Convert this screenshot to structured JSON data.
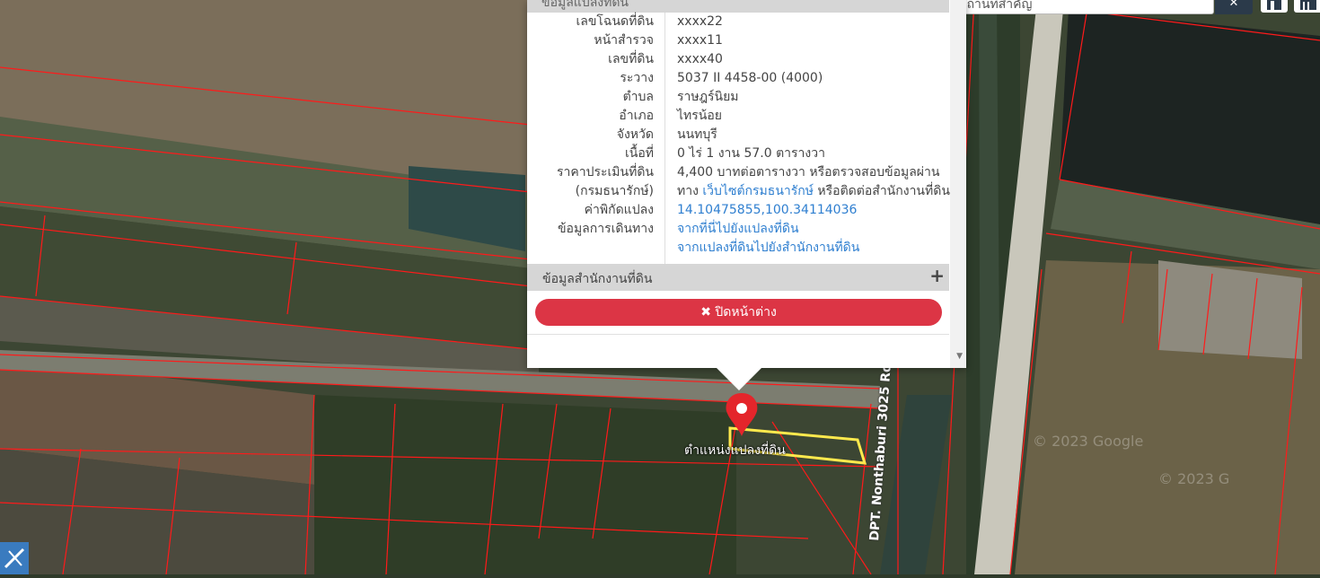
{
  "popup": {
    "header_title": "ข้อมูลแปลงที่ดิน",
    "rows": [
      {
        "label": "เลขโฉนดที่ดิน",
        "value": "xxxx22"
      },
      {
        "label": "หน้าสำรวจ",
        "value": "xxxx11"
      },
      {
        "label": "เลขที่ดิน",
        "value": "xxxx40"
      },
      {
        "label": "ระวาง",
        "value": "5037 II 4458-00 (4000)"
      },
      {
        "label": "ตำบล",
        "value": "ราษฎร์นิยม"
      },
      {
        "label": "อำเภอ",
        "value": "ไทรน้อย"
      },
      {
        "label": "จังหวัด",
        "value": "นนทบุรี"
      },
      {
        "label": "เนื้อที่",
        "value": "0 ไร่ 1 งาน 57.0 ตารางวา"
      }
    ],
    "price": {
      "label1": "ราคาประเมินที่ดิน",
      "label2": "(กรมธนารักษ์)",
      "line1": "4,400 บาทต่อตารางวา หรือตรวจสอบข้อมูลผ่าน",
      "line2_prefix": "ทาง ",
      "line2_link": "เว็บไซต์กรมธนารักษ์",
      "line2_suffix": " หรือติดต่อสำนักงานที่ดิน"
    },
    "coords": {
      "label": "ค่าพิกัดแปลง",
      "value": "14.10475855,100.34114036"
    },
    "travel": {
      "label": "ข้อมูลการเดินทาง",
      "link1": "จากที่นี่ไปยังแปลงที่ดิน",
      "link2": "จากแปลงที่ดินไปยังสำนักงานที่ดิน"
    },
    "section_title": "ข้อมูลสำนักงานที่ดิน",
    "section_toggle": "+",
    "close_label": "✖ ปิดหน้าต่าง"
  },
  "search": {
    "placeholder": "ค้นหาสถานที่สำคัญ",
    "button_icon": "close-icon"
  },
  "map": {
    "marker_label": "ตำแหน่งแปลงที่ดิน",
    "road_label": "DPT. Nonthaburi 3025 Rd",
    "copyright1": "© 2023 Google",
    "copyright2": "© 2023 G"
  },
  "colors": {
    "parcel_lines": "#ff1a1a",
    "selected_parcel": "#ffe94d",
    "close_button": "#dc3545",
    "link": "#2f7fd0"
  }
}
